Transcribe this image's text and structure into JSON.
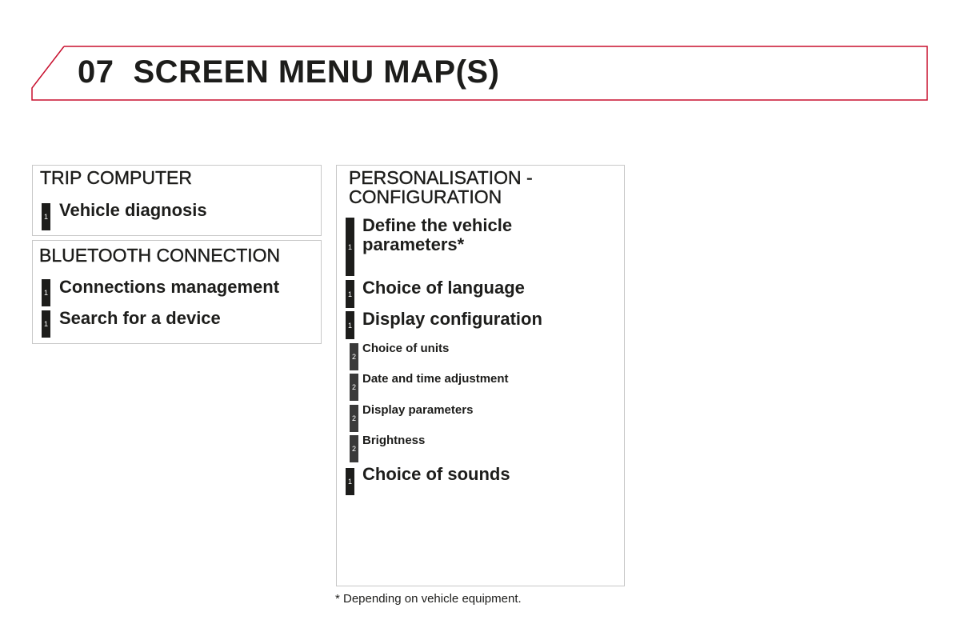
{
  "header": {
    "number": "07",
    "title": "SCREEN MENU MAP(S)",
    "accent_color": "#c8102e"
  },
  "panels": {
    "trip": {
      "title": "TRIP COMPUTER",
      "items": [
        {
          "level": "1",
          "label": "Vehicle diagnosis"
        }
      ]
    },
    "bluetooth": {
      "title": "BLUETOOTH CONNECTION",
      "items": [
        {
          "level": "1",
          "label": "Connections management"
        },
        {
          "level": "1",
          "label": "Search for a device"
        }
      ]
    },
    "personalisation": {
      "title_line1": "PERSONALISATION -",
      "title_line2": "CONFIGURATION",
      "items": [
        {
          "level": "1",
          "label_line1": "Define the vehicle",
          "label_line2": "parameters*"
        },
        {
          "level": "1",
          "label": "Choice of language"
        },
        {
          "level": "1",
          "label": "Display configuration"
        },
        {
          "level": "2",
          "label": "Choice of units"
        },
        {
          "level": "2",
          "label": "Date and time adjustment"
        },
        {
          "level": "2",
          "label": "Display parameters"
        },
        {
          "level": "2",
          "label": "Brightness"
        },
        {
          "level": "1",
          "label": "Choice of sounds"
        }
      ]
    }
  },
  "footnote": "* Depending on vehicle equipment."
}
